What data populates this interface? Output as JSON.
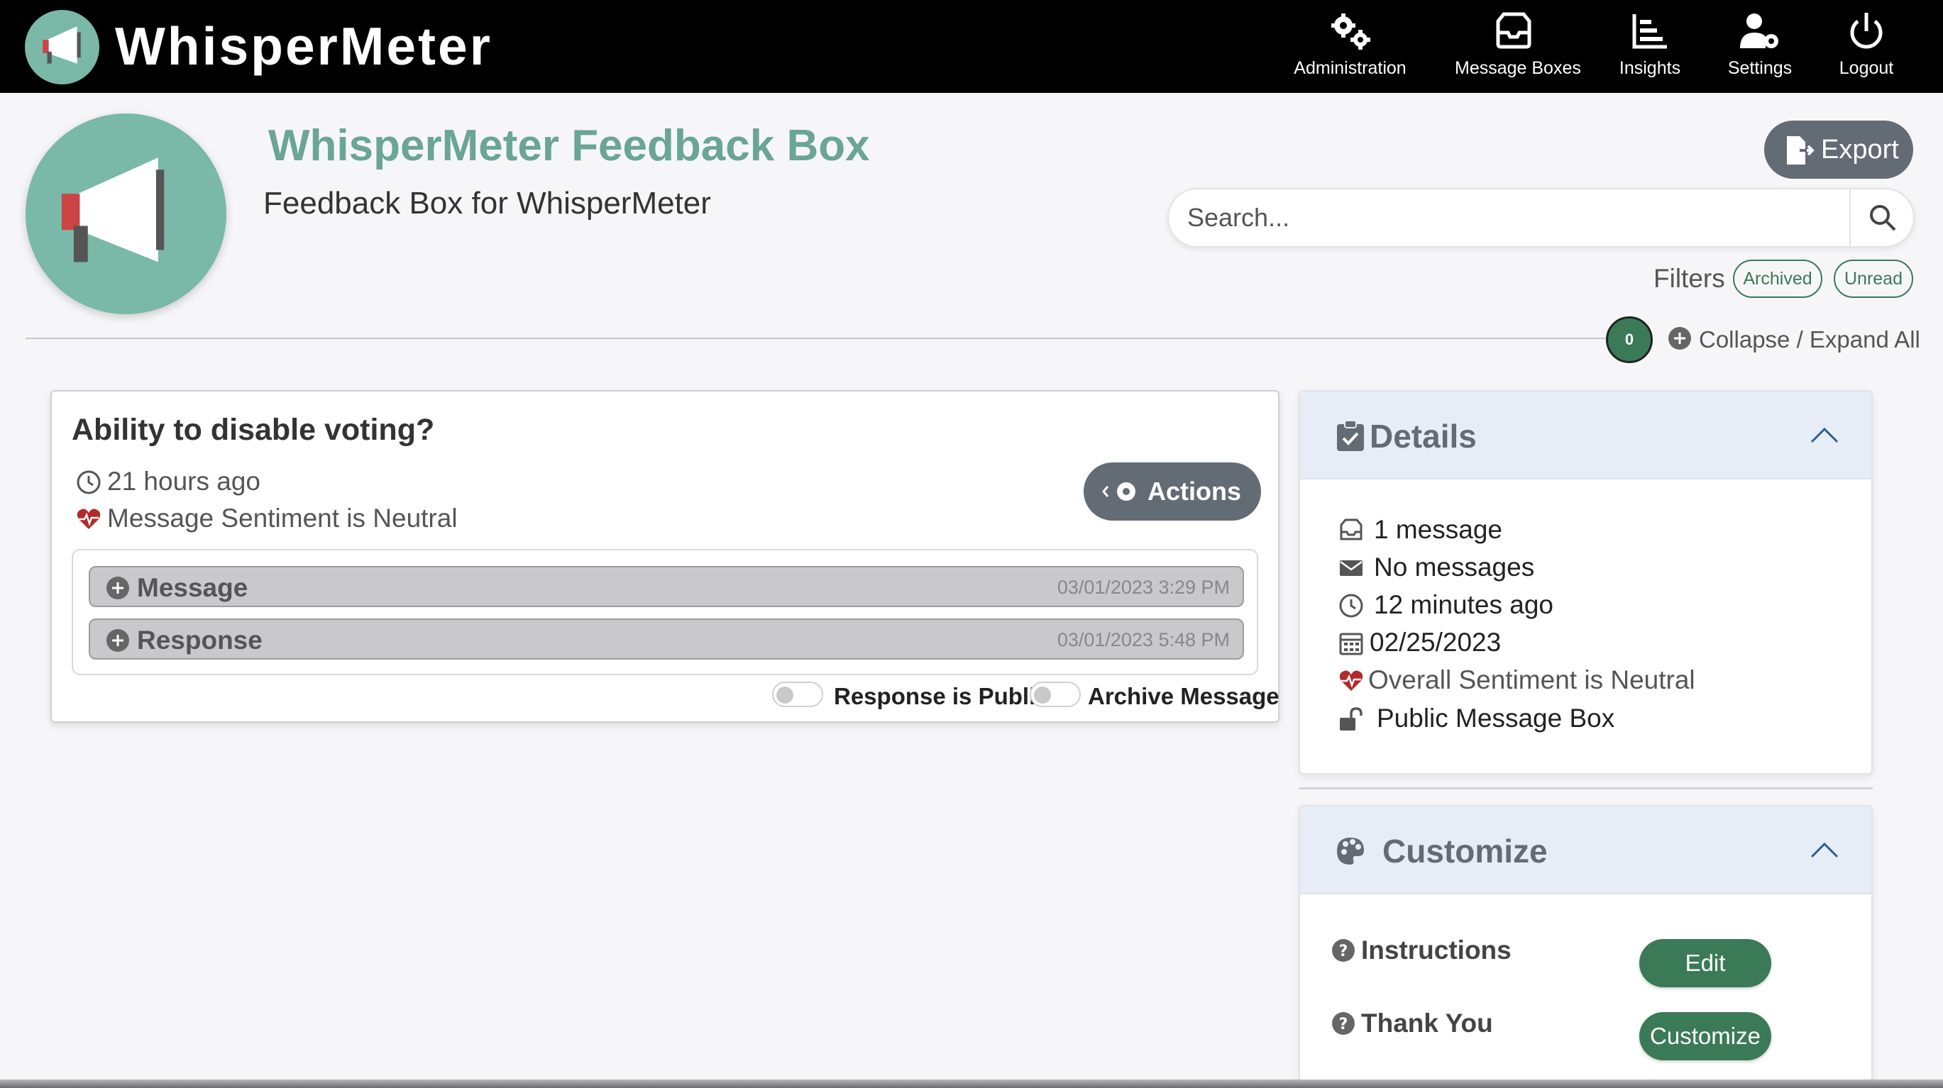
{
  "app": {
    "name": "WhisperMeter",
    "brand_color": "#7ab8a8",
    "accent_green": "#3b7a57"
  },
  "nav": {
    "items": [
      {
        "label": "Administration",
        "icon": "gears-icon"
      },
      {
        "label": "Message Boxes",
        "icon": "inbox-icon"
      },
      {
        "label": "Insights",
        "icon": "chart-icon"
      },
      {
        "label": "Settings",
        "icon": "user-gear-icon"
      },
      {
        "label": "Logout",
        "icon": "power-icon"
      }
    ]
  },
  "box": {
    "title": "WhisperMeter Feedback Box",
    "subtitle": "Feedback Box for WhisperMeter"
  },
  "toolbar": {
    "export_label": "Export",
    "search_placeholder": "Search...",
    "filters_label": "Filters",
    "filters": [
      "Archived",
      "Unread"
    ],
    "count": "0",
    "collapse_label": "Collapse / Expand All"
  },
  "message": {
    "title": "Ability to disable voting?",
    "time_ago": "21 hours ago",
    "sentiment": "Message Sentiment is Neutral",
    "actions_label": "Actions",
    "sections": [
      {
        "label": "Message",
        "timestamp": "03/01/2023 3:29 PM"
      },
      {
        "label": "Response",
        "timestamp": "03/01/2023 5:48 PM"
      }
    ],
    "toggles": [
      {
        "label": "Response is Public",
        "on": false
      },
      {
        "label": "Archive Message",
        "on": false
      }
    ]
  },
  "details": {
    "title": "Details",
    "rows": [
      {
        "icon": "inbox-icon",
        "text": "1 message"
      },
      {
        "icon": "envelope-icon",
        "text": "No messages"
      },
      {
        "icon": "clock-icon",
        "text": "12 minutes ago"
      },
      {
        "icon": "calendar-icon",
        "text": "02/25/2023"
      },
      {
        "icon": "heartbeat-icon",
        "text": "Overall Sentiment is Neutral"
      },
      {
        "icon": "unlock-icon",
        "text": "Public Message Box"
      }
    ]
  },
  "customize": {
    "title": "Customize",
    "rows": [
      {
        "label": "Instructions",
        "button": "Edit"
      },
      {
        "label": "Thank You",
        "button": "Customize"
      }
    ]
  }
}
